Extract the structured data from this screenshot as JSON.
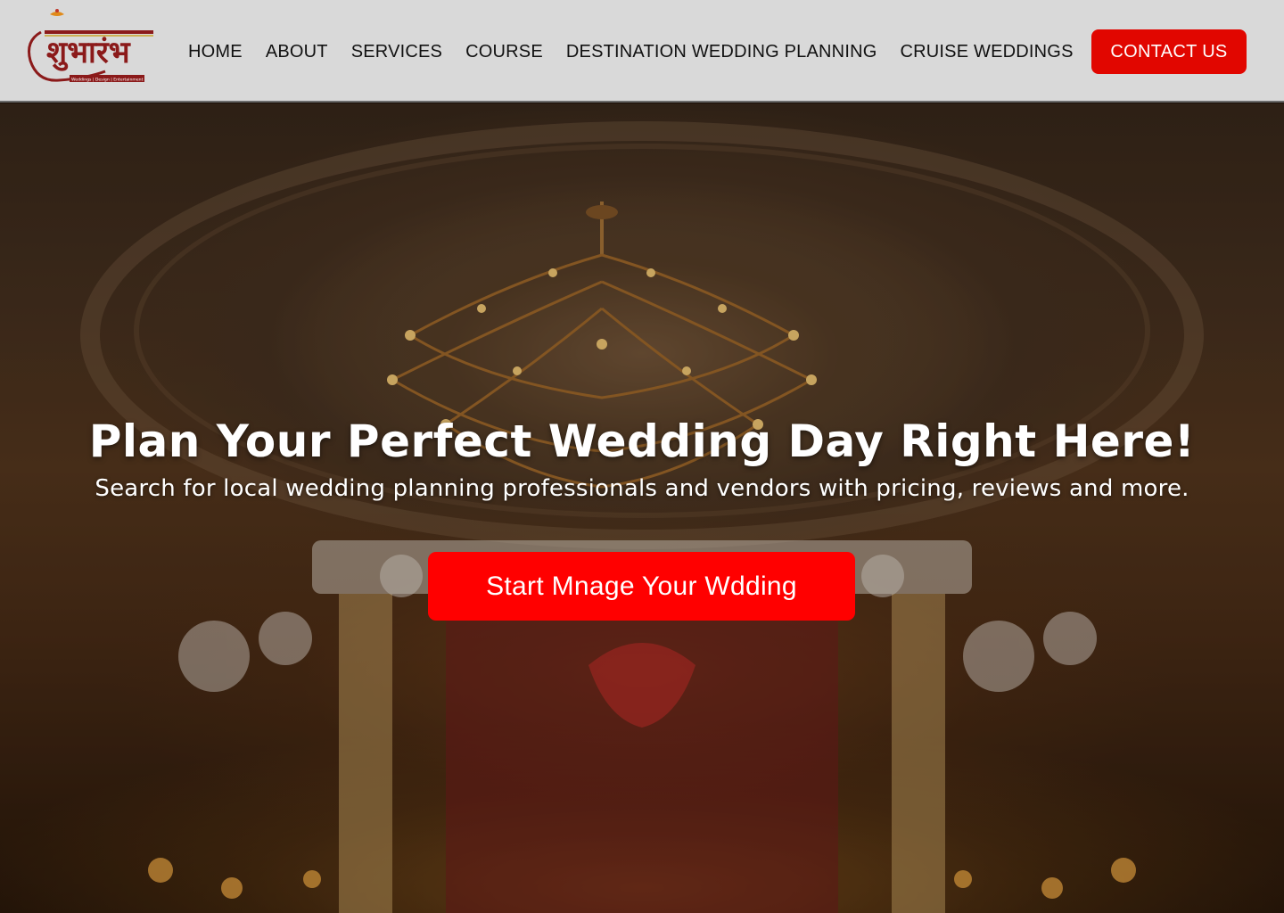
{
  "header": {
    "logo_text": "शुभारंभ",
    "logo_tagline": "Weddings | Design | Entertainment",
    "nav": [
      {
        "label": "HOME"
      },
      {
        "label": "ABOUT"
      },
      {
        "label": "SERVICES"
      },
      {
        "label": "COURSE"
      },
      {
        "label": "DESTINATION WEDDING PLANNING"
      },
      {
        "label": "CRUISE WEDDINGS"
      }
    ],
    "contact_label": "CONTACT US"
  },
  "hero": {
    "title": "Plan Your Perfect Wedding Day Right Here!",
    "subtitle": "Search for local wedding planning professionals and vendors with pricing, reviews and more.",
    "cta_label": "Start Mnage Your Wdding"
  },
  "colors": {
    "header_bg": "#d9d9d9",
    "accent_red": "#e10600",
    "cta_red": "#ff0000",
    "logo_maroon": "#8b1a1a"
  },
  "icons": [
    "logo-emblem",
    "chandelier-image",
    "mandap-image"
  ]
}
